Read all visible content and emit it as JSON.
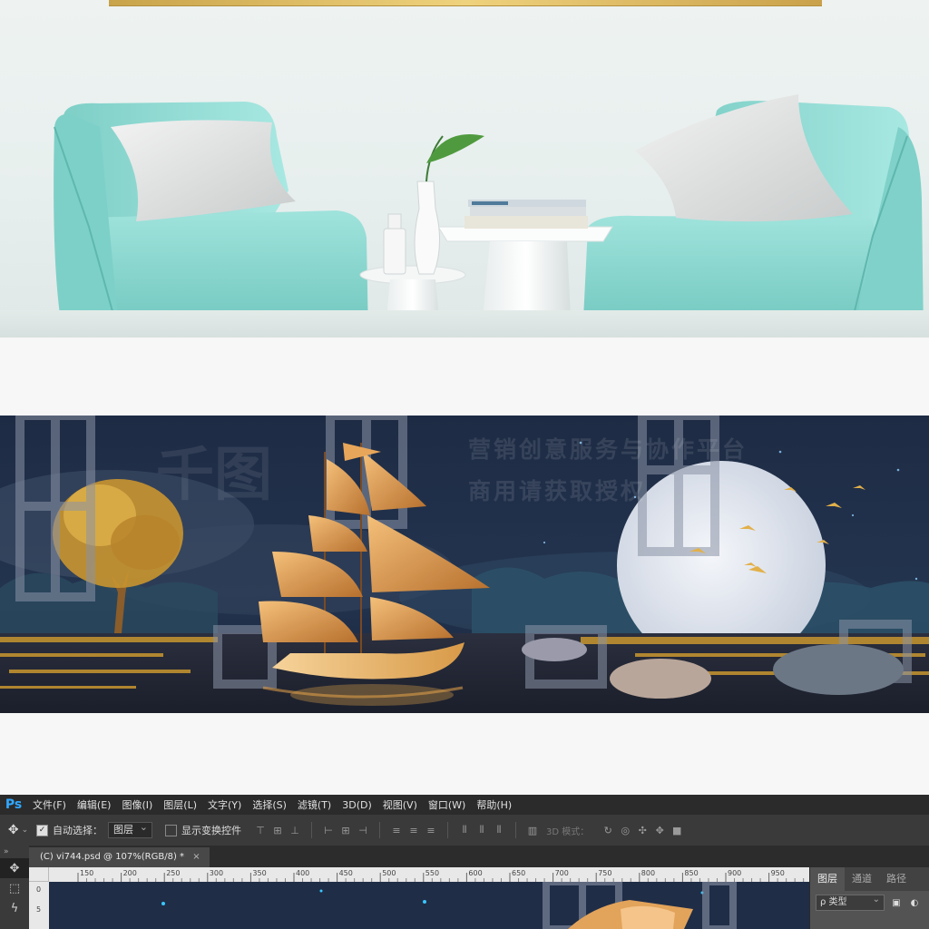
{
  "room": {
    "objects": [
      "frame-edge",
      "armchair-left",
      "armchair-right",
      "pillow-left",
      "pillow-right",
      "side-table",
      "vase",
      "books",
      "small-bottle"
    ]
  },
  "artwork": {
    "watermark_line1": "营销创意服务与协作平台",
    "watermark_line2": "商用请获取授权",
    "watermark_logo": "千图"
  },
  "photoshop": {
    "app_logo": "Ps",
    "menu": [
      "文件(F)",
      "编辑(E)",
      "图像(I)",
      "图层(L)",
      "文字(Y)",
      "选择(S)",
      "滤镜(T)",
      "3D(D)",
      "视图(V)",
      "窗口(W)",
      "帮助(H)"
    ],
    "options": {
      "auto_select_label": "自动选择：",
      "auto_select_checked": true,
      "auto_select_value": "图层",
      "show_transform_label": "显示变换控件",
      "show_transform_checked": false,
      "mode_3d_label": "3D 模式："
    },
    "document_tab": {
      "title": "(C) vi744.psd @ 107%(RGB/8) *",
      "close": "×"
    },
    "ruler_labels": [
      "150",
      "200",
      "250",
      "300",
      "350",
      "400",
      "450",
      "500",
      "550",
      "600",
      "650",
      "700",
      "750",
      "800",
      "850",
      "900",
      "950"
    ],
    "panel_tabs": [
      "图层",
      "通道",
      "路径"
    ],
    "active_panel_tab": "图层",
    "layer_filter": {
      "prefix": "ρ",
      "value": "类型"
    },
    "collapse_arrows": "»"
  },
  "colors": {
    "ps_dark": "#2b2b2b",
    "ps_mid": "#3a3a3a",
    "ps_panel": "#535353",
    "ps_blue": "#31a8ff",
    "art_night": "#1c2a42",
    "gold": "#e0a24a",
    "chair_teal": "#8fd9d2"
  }
}
